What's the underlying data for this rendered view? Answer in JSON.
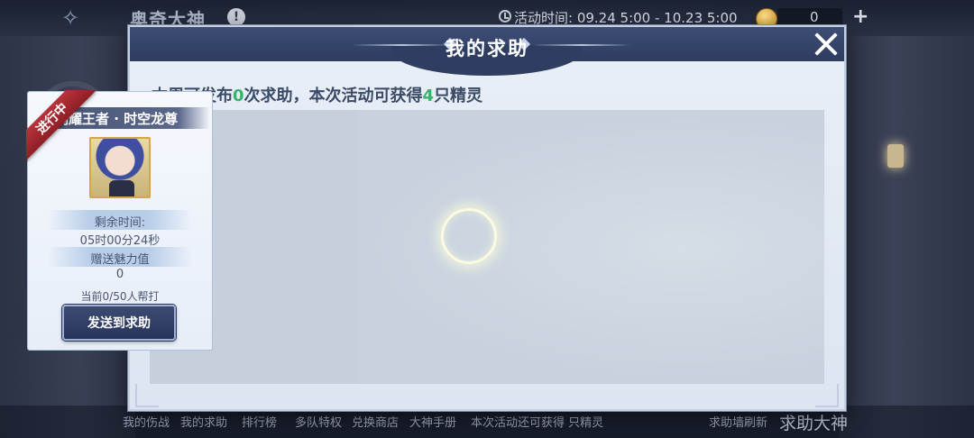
{
  "hud": {
    "logo_glyph": "✧",
    "game_title": "奥奇大神",
    "info_glyph": "!",
    "activity_time": "活动时间: 09.24 5:00 - 10.23 5:00",
    "coin_count": "0",
    "plus_glyph": "+"
  },
  "bottom_nav": {
    "items": [
      "我的伤战",
      "我的求助",
      "排行榜",
      "多队特权",
      "兑换商店",
      "大神手册",
      "本次活动还可获得 只精灵",
      "求助墙刷新"
    ],
    "big_label": "求助大神"
  },
  "modal": {
    "title": "我的求助",
    "summary_prefix": "本周可发布",
    "summary_count": "0",
    "summary_middle": "次求助，本次活动可获得",
    "summary_reward": "4",
    "summary_suffix": "只精灵"
  },
  "card": {
    "status": "进行中",
    "name": "闪耀王者 · 时空龙尊",
    "remaining_label": "剩余时间:",
    "remaining_value": "05时00分24秒",
    "charm_label": "赠送魅力值",
    "charm_value": "0",
    "helpers": "当前0/50人帮打",
    "send_button": "发送到求助"
  },
  "colors": {
    "highlight": "#34b36a",
    "header": "#2e3c60",
    "ribbon": "#b8333a"
  },
  "icons": [
    "close-icon",
    "clock-icon",
    "coin-icon",
    "info-icon",
    "plus-icon",
    "loading-spinner"
  ]
}
